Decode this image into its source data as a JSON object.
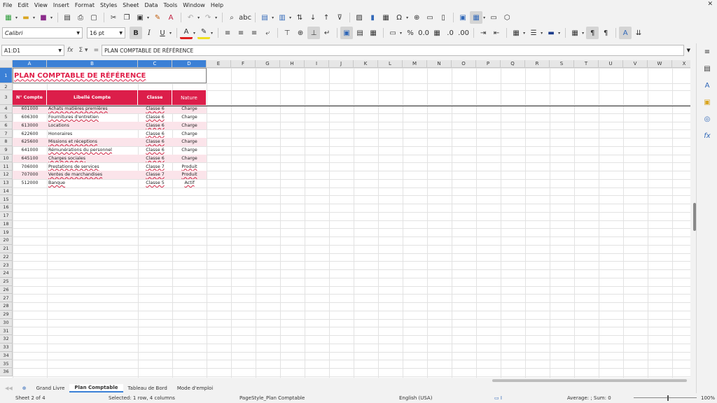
{
  "menu": [
    "File",
    "Edit",
    "View",
    "Insert",
    "Format",
    "Styles",
    "Sheet",
    "Data",
    "Tools",
    "Window",
    "Help"
  ],
  "font_name": "Calibri",
  "font_size": "16 pt",
  "name_box": "A1:D1",
  "formula": "PLAN COMPTABLE DE RÉFÉRENCE",
  "columns": [
    "A",
    "B",
    "C",
    "D",
    "E",
    "F",
    "G",
    "H",
    "I",
    "J",
    "K",
    "L",
    "M",
    "N",
    "O",
    "P",
    "Q",
    "R",
    "S",
    "T",
    "U",
    "V",
    "W",
    "X"
  ],
  "rows": [
    "1",
    "2",
    "3",
    "4",
    "5",
    "6",
    "7",
    "8",
    "9",
    "10",
    "11",
    "12",
    "13",
    "14",
    "15",
    "16",
    "17",
    "18",
    "19",
    "20",
    "21",
    "22",
    "23",
    "24",
    "25",
    "26",
    "27",
    "28",
    "29",
    "30",
    "31",
    "32",
    "33",
    "34",
    "35",
    "36"
  ],
  "title": "PLAN COMPTABLE DE RÉFÉRENCE",
  "headers": {
    "num": "N° Compte",
    "label": "Libellé Compte",
    "class": "Classe",
    "nature": "Nature"
  },
  "accounts": [
    {
      "num": "601000",
      "label": "Achats matières premières",
      "class": "Classe 6",
      "nature": "Charge"
    },
    {
      "num": "606300",
      "label": "Fournitures d'entretien",
      "class": "Classe 6",
      "nature": "Charge"
    },
    {
      "num": "613000",
      "label": "Locations",
      "class": "Classe 6",
      "nature": "Charge"
    },
    {
      "num": "622600",
      "label": "Honoraires",
      "class": "Classe 6",
      "nature": "Charge"
    },
    {
      "num": "625600",
      "label": "Missions et réceptions",
      "class": "Classe 6",
      "nature": "Charge"
    },
    {
      "num": "641000",
      "label": "Rémunérations du personnel",
      "class": "Classe 6",
      "nature": "Charge"
    },
    {
      "num": "645100",
      "label": "Charges sociales",
      "class": "Classe 6",
      "nature": "Charge"
    },
    {
      "num": "706000",
      "label": "Prestations de services",
      "class": "Classe 7",
      "nature": "Produit"
    },
    {
      "num": "707000",
      "label": "Ventes de marchandises",
      "class": "Classe 7",
      "nature": "Produit"
    },
    {
      "num": "512000",
      "label": "Banque",
      "class": "Classe 5",
      "nature": "Actif"
    }
  ],
  "tabs": [
    "Grand Livre",
    "Plan Comptable",
    "Tableau de Bord",
    "Mode d'emploi"
  ],
  "active_tab": "Plan Comptable",
  "status": {
    "sheet": "Sheet 2 of 4",
    "selection": "Selected: 1 row, 4 columns",
    "page_style": "PageStyle_Plan Comptable",
    "language": "English (USA)",
    "summary": "Average: ; Sum: 0",
    "zoom": "100%"
  },
  "colors": {
    "accent": "#dc1e4a",
    "stripe": "#fbe4ea",
    "selection": "#3b80d6"
  }
}
